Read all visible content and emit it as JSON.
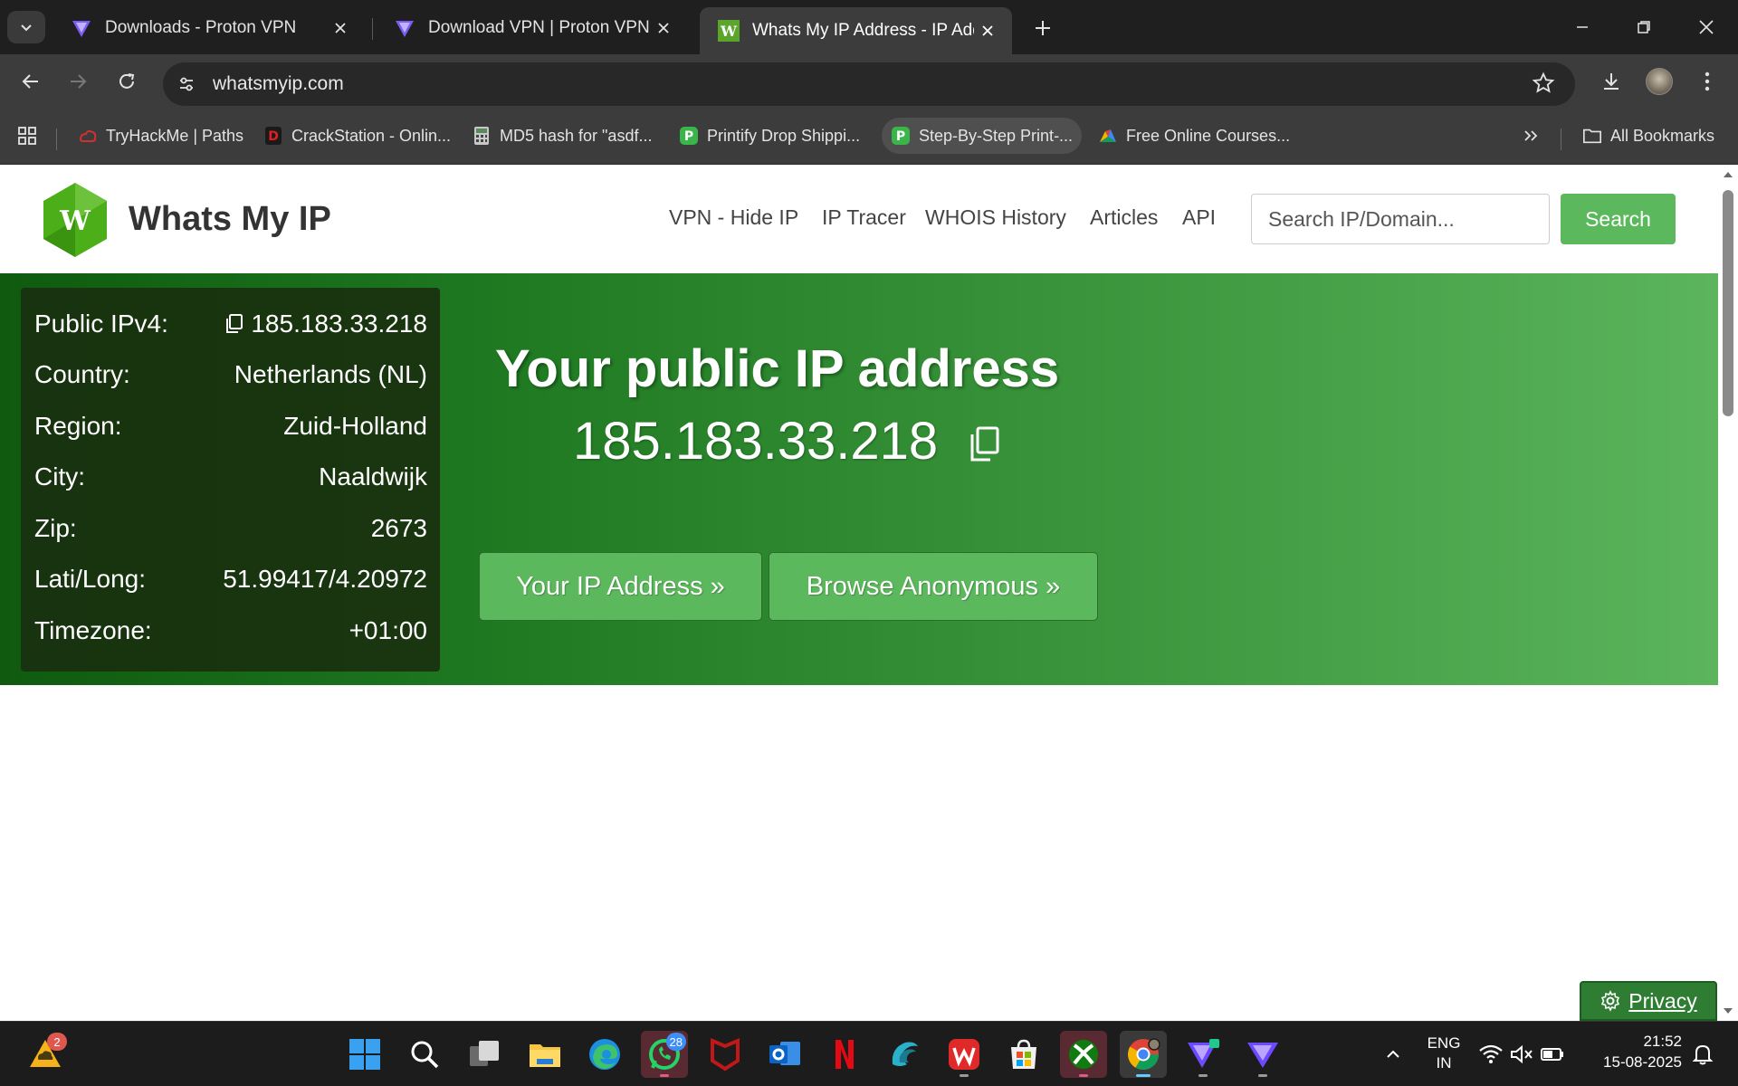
{
  "browser": {
    "tabs": [
      {
        "title": "Downloads - Proton VPN",
        "active": false
      },
      {
        "title": "Download VPN | Proton VPN",
        "active": false
      },
      {
        "title": "Whats My IP Address - IP Addre",
        "active": true
      }
    ],
    "url": "whatsmyip.com",
    "bookmarks": [
      "TryHackMe | Paths",
      "CrackStation - Onlin...",
      "MD5 hash for \"asdf...",
      "Printify Drop Shippi...",
      "Step-By-Step Print-...",
      "Free Online Courses..."
    ],
    "all_bookmarks": "All Bookmarks"
  },
  "site": {
    "logo_letter": "W",
    "brand": "Whats My IP",
    "menu": [
      "VPN - Hide IP",
      "IP Tracer",
      "WHOIS History",
      "Articles",
      "API"
    ],
    "search_placeholder": "Search IP/Domain...",
    "search_button": "Search"
  },
  "info": {
    "rows": [
      {
        "key": "Public IPv4:",
        "value": "185.183.33.218"
      },
      {
        "key": "Country:",
        "value": "Netherlands (NL)"
      },
      {
        "key": "Region:",
        "value": "Zuid-Holland"
      },
      {
        "key": "City:",
        "value": "Naaldwijk"
      },
      {
        "key": "Zip:",
        "value": "2673"
      },
      {
        "key": "Lati/Long:",
        "value": "51.99417/4.20972"
      },
      {
        "key": "Timezone:",
        "value": "+01:00"
      }
    ]
  },
  "hero": {
    "title": "Your public IP address",
    "ip": "185.183.33.218",
    "button_ip": "Your IP Address »",
    "button_anon": "Browse Anonymous »"
  },
  "privacy": {
    "label": "Privacy"
  },
  "taskbar": {
    "weather_badge": "2",
    "whatsapp_badge": "28",
    "language": "ENG",
    "region": "IN",
    "time": "21:52",
    "date": "15-08-2025"
  },
  "colors": {
    "accent_green": "#5cb85c",
    "hero_dark": "#0f5a0f",
    "hero_light": "#5cb55c"
  }
}
